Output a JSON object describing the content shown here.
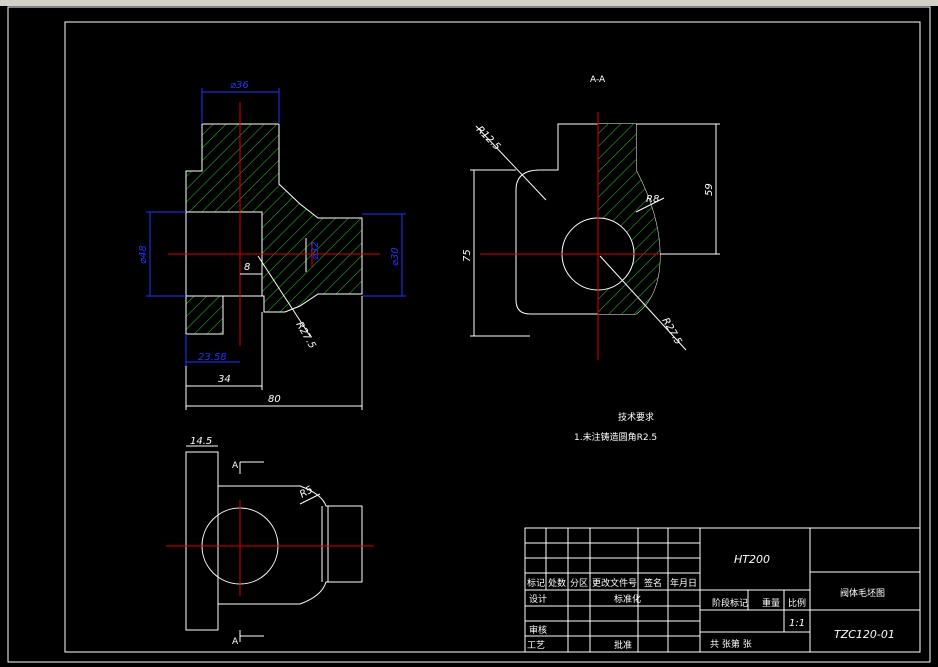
{
  "views": {
    "section_AA_label": "A-A",
    "arrow_label": "A"
  },
  "dims": {
    "d36": "⌀36",
    "d48": "⌀48",
    "d30": "⌀30",
    "d32": "⌀32",
    "len8": "8",
    "r275_front": "R27.5",
    "len2358": "23.58",
    "len34": "34",
    "len80": "80",
    "r125": "R12.5",
    "r8": "R8",
    "len59": "59",
    "len75": "75",
    "r275_side": "R27.5",
    "len145": "14.5",
    "r5": "R5"
  },
  "notes": {
    "title": "技术要求",
    "line1": "1.未注铸造圆角R2.5"
  },
  "title_block": {
    "material": "HT200",
    "part_name": "阀体毛坯图",
    "drawing_no": "TZC120-01",
    "scale": "1:1",
    "headers": [
      "标记",
      "处数",
      "分区",
      "更改文件号",
      "签名",
      "年月日"
    ],
    "design": "设计",
    "standardize": "标准化",
    "review": "审核",
    "process": "工艺",
    "approve": "批准",
    "stage_mark": "阶段标记",
    "weight": "重量",
    "ratio": "比例",
    "sheets": "共  张第 张"
  }
}
